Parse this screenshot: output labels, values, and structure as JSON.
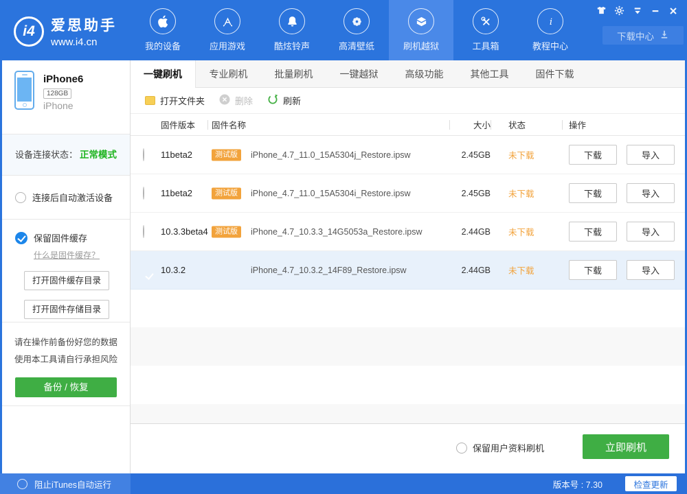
{
  "titlebar": {
    "logo": {
      "badge": "i4",
      "title": "爱思助手",
      "subtitle": "www.i4.cn"
    },
    "nav": [
      {
        "label": "我的设备",
        "icon": "apple-icon",
        "active": false
      },
      {
        "label": "应用游戏",
        "icon": "appstore-icon",
        "active": false
      },
      {
        "label": "酷炫铃声",
        "icon": "bell-icon",
        "active": false
      },
      {
        "label": "高清壁纸",
        "icon": "flower-icon",
        "active": false
      },
      {
        "label": "刷机越狱",
        "icon": "open-box-icon",
        "active": true
      },
      {
        "label": "工具箱",
        "icon": "tools-icon",
        "active": false
      },
      {
        "label": "教程中心",
        "icon": "info-icon",
        "active": false
      }
    ],
    "window_controls": [
      "skin-icon",
      "settings-gear-icon",
      "main-menu-icon",
      "minimize-icon",
      "close-icon"
    ],
    "download_center": "下载中心"
  },
  "sidebar": {
    "device": {
      "name": "iPhone6",
      "capacity": "128GB",
      "type": "iPhone"
    },
    "connection": {
      "label": "设备连接状态：",
      "value": "正常模式"
    },
    "auto_activate": "连接后自动激活设备",
    "keep_cache": "保留固件缓存",
    "cache_help": "什么是固件缓存？",
    "open_cache_dir": "打开固件缓存目录",
    "open_storage_dir": "打开固件存储目录",
    "warning_line1": "请在操作前备份好您的数据",
    "warning_line2": "使用本工具请自行承担风险",
    "backup_restore": "备份 / 恢复",
    "block_itunes": "阻止iTunes自动运行"
  },
  "tabs": [
    {
      "label": "一键刷机",
      "active": true
    },
    {
      "label": "专业刷机",
      "active": false
    },
    {
      "label": "批量刷机",
      "active": false
    },
    {
      "label": "一键越狱",
      "active": false
    },
    {
      "label": "高级功能",
      "active": false
    },
    {
      "label": "其他工具",
      "active": false
    },
    {
      "label": "固件下载",
      "active": false
    }
  ],
  "toolbar": {
    "open_folder": "打开文件夹",
    "delete": "删除",
    "refresh": "刷新"
  },
  "table": {
    "headers": {
      "version": "固件版本",
      "name": "固件名称",
      "size": "大小",
      "status": "状态",
      "ops": "操作"
    },
    "rows": [
      {
        "version": "11beta2",
        "badge": "测试版",
        "filename": "iPhone_4.7_11.0_15A5304j_Restore.ipsw",
        "size": "2.45GB",
        "status": "未下载",
        "download": "下载",
        "import": "导入",
        "selected": false
      },
      {
        "version": "11beta2",
        "badge": "测试版",
        "filename": "iPhone_4.7_11.0_15A5304i_Restore.ipsw",
        "size": "2.45GB",
        "status": "未下载",
        "download": "下载",
        "import": "导入",
        "selected": false
      },
      {
        "version": "10.3.3beta4",
        "badge": "测试版",
        "filename": "iPhone_4.7_10.3.3_14G5053a_Restore.ipsw",
        "size": "2.44GB",
        "status": "未下载",
        "download": "下载",
        "import": "导入",
        "selected": false
      },
      {
        "version": "10.3.2",
        "badge": "",
        "filename": "iPhone_4.7_10.3.2_14F89_Restore.ipsw",
        "size": "2.44GB",
        "status": "未下载",
        "download": "下载",
        "import": "导入",
        "selected": true
      }
    ]
  },
  "flash_bar": {
    "keep_user_data": "保留用户资料刷机",
    "flash_now": "立即刷机"
  },
  "statusbar": {
    "version": "版本号 : 7.30",
    "check_update": "检查更新"
  },
  "colors": {
    "header_blue": "#2b74dd",
    "active_nav_blue": "#4a89e8",
    "footer_light_blue": "#4281e2",
    "green_button": "#3fae44",
    "green_status_text": "#1eb41e",
    "orange_badge": "#f2a33c",
    "selected_row_bg": "#e8f1fb",
    "check_blue": "#1c86ea"
  }
}
